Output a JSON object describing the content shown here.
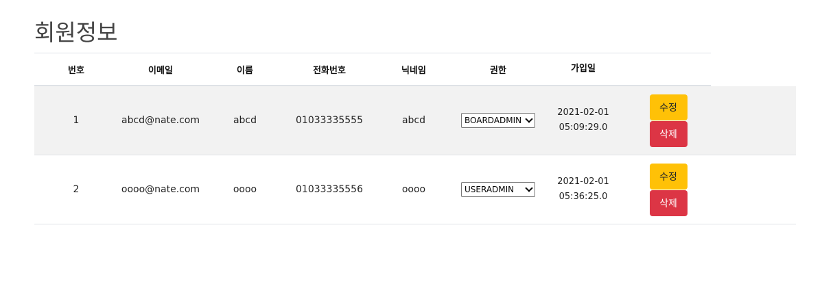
{
  "page": {
    "title": "회원정보"
  },
  "table": {
    "headers": {
      "no": "번호",
      "email": "이메일",
      "name": "이름",
      "phone": "전화번호",
      "nickname": "닉네임",
      "role": "권한",
      "joined": "가입일",
      "actions": ""
    },
    "rows": [
      {
        "no": "1",
        "email": "abcd@nate.com",
        "name": "abcd",
        "phone": "01033335555",
        "nickname": "abcd",
        "role": "BOARDADMIN",
        "joined_date": "2021-02-01",
        "joined_time": "05:09:29.0",
        "edit_label": "수정",
        "delete_label": "삭제"
      },
      {
        "no": "2",
        "email": "oooo@nate.com",
        "name": "oooo",
        "phone": "01033335556",
        "nickname": "oooo",
        "role": "USERADMIN",
        "joined_date": "2021-02-01",
        "joined_time": "05:36:25.0",
        "edit_label": "수정",
        "delete_label": "삭제"
      }
    ]
  },
  "colors": {
    "edit_button": "#ffc107",
    "delete_button": "#dc3545",
    "striped_row": "#f2f2f2"
  },
  "icons": {
    "select_arrow": "chevron-down-icon"
  }
}
